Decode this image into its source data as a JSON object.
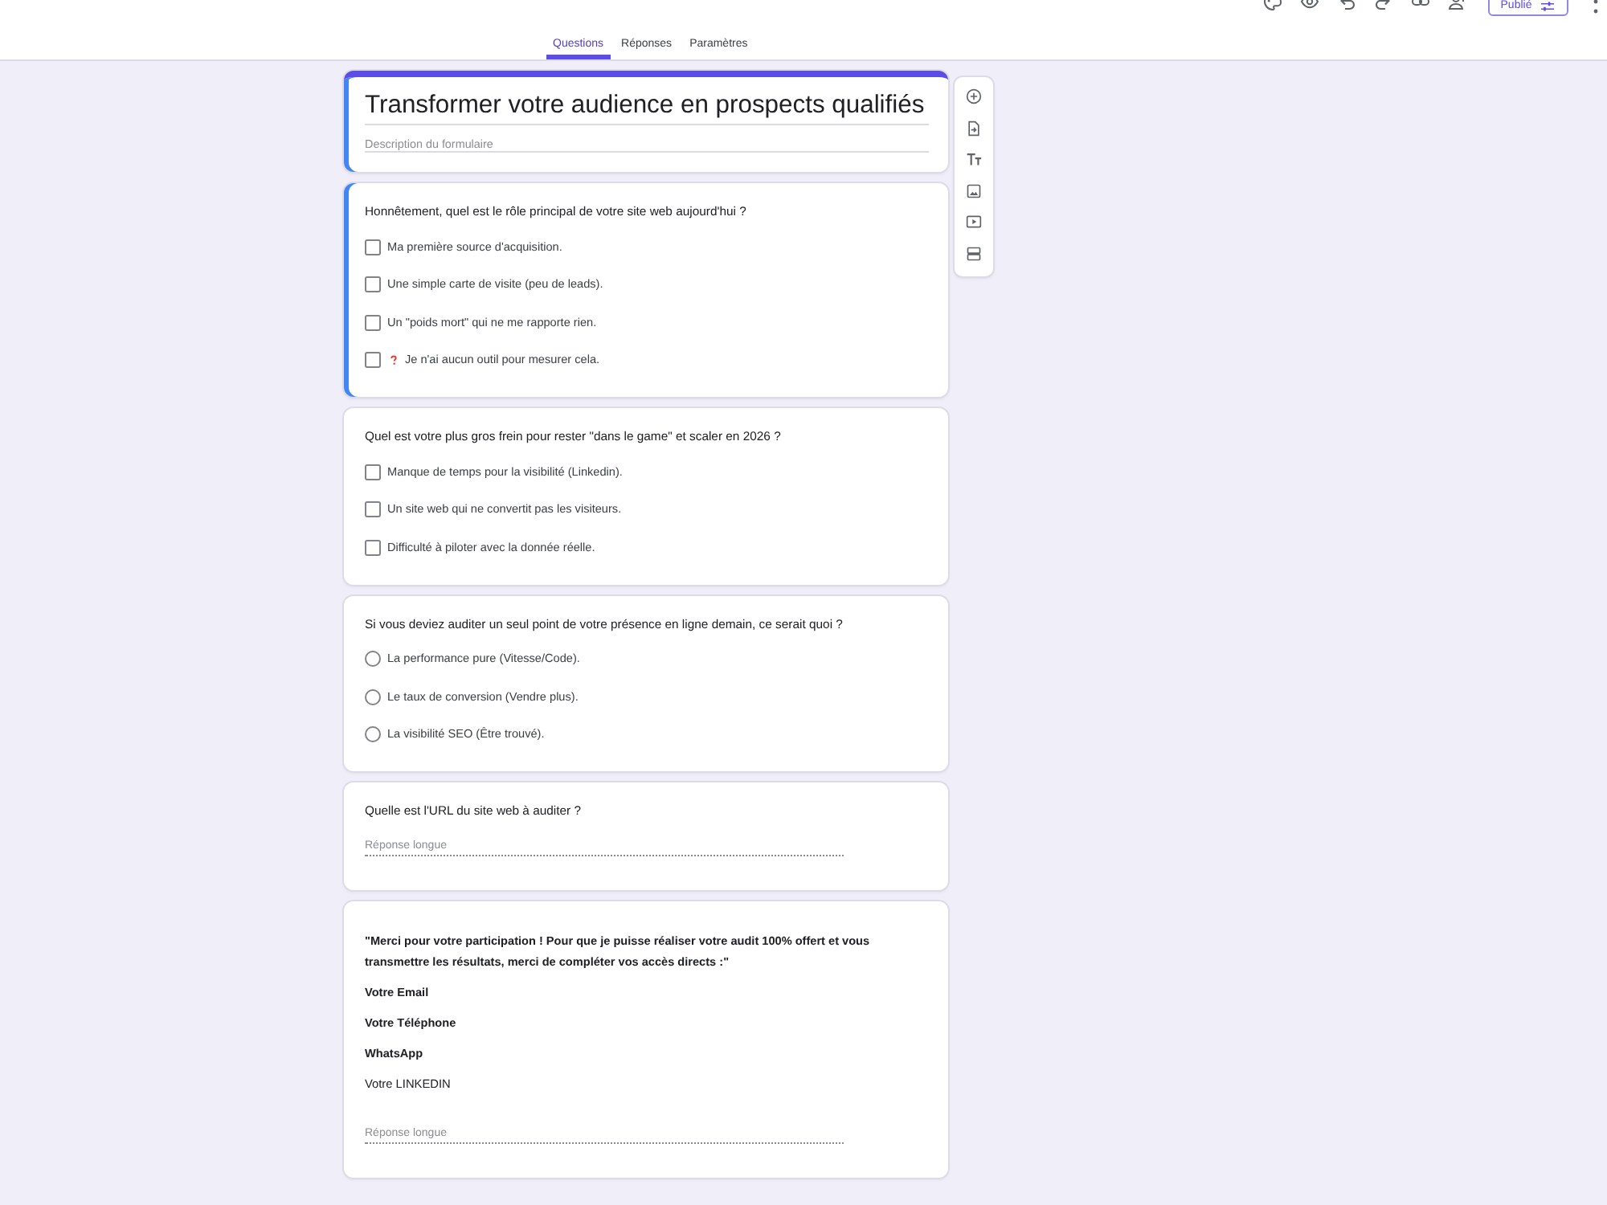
{
  "toolbar": {
    "publish_button": {
      "label": "Publié"
    }
  },
  "tabs": [
    {
      "label": "Questions",
      "selected": true
    },
    {
      "label": "Réponses",
      "selected": false
    },
    {
      "label": "Paramètres",
      "selected": false
    }
  ],
  "form_header": {
    "title": "Transformer votre audience en prospects qualifiés",
    "description_placeholder": "Description du formulaire",
    "selected": true
  },
  "questions": [
    {
      "kind": "checkbox",
      "selected": true,
      "title": "Honnêtement, quel est le rôle principal de votre site web aujourd'hui ?",
      "options": [
        {
          "text": "Ma première source d'acquisition.",
          "has_icon": false
        },
        {
          "text": "Une simple carte de visite (peu de leads).",
          "has_icon": false
        },
        {
          "text": "Un \"poids mort\" qui ne me rapporte rien.",
          "has_icon": false
        },
        {
          "text": "Je n'ai aucun outil pour mesurer cela.",
          "has_icon": true
        }
      ]
    },
    {
      "kind": "checkbox",
      "selected": false,
      "title": "Quel est votre plus gros frein pour rester \"dans le game\" et scaler en 2026 ?",
      "options": [
        {
          "text": "Manque de temps pour la visibilité (Linkedin)."
        },
        {
          "text": "Un site web qui ne convertit pas les visiteurs."
        },
        {
          "text": "Difficulté à piloter avec la donnée réelle."
        }
      ]
    },
    {
      "kind": "radio",
      "selected": false,
      "title": "Si vous deviez auditer un seul point de votre présence en ligne demain, ce serait quoi ?",
      "options": [
        {
          "text": "La performance pure (Vitesse/Code)."
        },
        {
          "text": "Le taux de conversion (Vendre plus)."
        },
        {
          "text": "La visibilité SEO (Être trouvé)."
        }
      ]
    },
    {
      "kind": "paragraph",
      "selected": false,
      "title": "Quelle est l'URL du site web à auditer ?",
      "answer_placeholder": "Réponse longue"
    },
    {
      "kind": "paragraph",
      "selected": false,
      "title_lines": [
        {
          "text": "\"Merci pour votre participation ! Pour que je puisse réaliser votre audit 100% offert et vous transmettre les résultats, merci de compléter vos accès directs :\"",
          "bold": true
        },
        {
          "text": "Votre Email",
          "bold": true
        },
        {
          "text": "Votre Téléphone",
          "bold": true
        },
        {
          "text": "WhatsApp",
          "bold": true
        },
        {
          "text": "Votre LINKEDIN",
          "bold": false
        }
      ],
      "answer_placeholder": "Réponse longue"
    }
  ]
}
